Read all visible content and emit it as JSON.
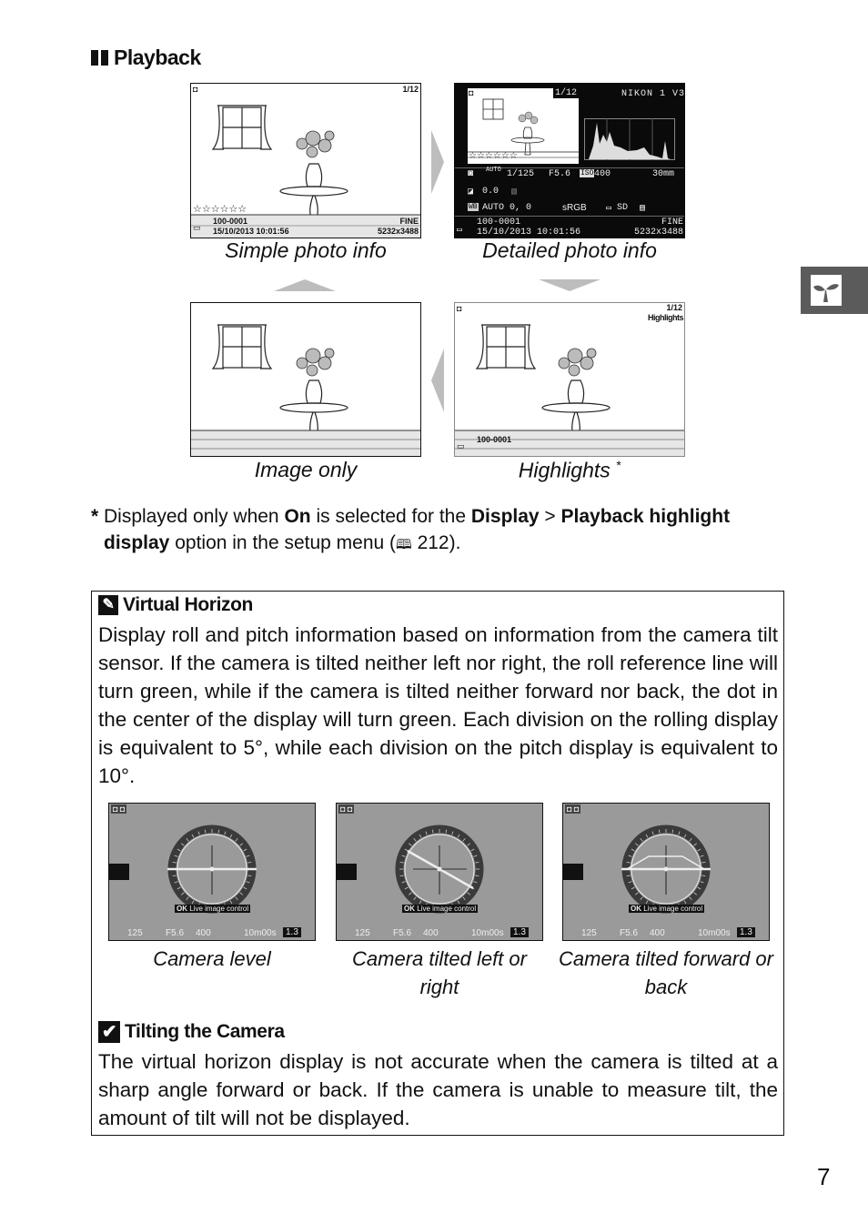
{
  "section": {
    "title": "Playback"
  },
  "playback_views": [
    {
      "id": "simple",
      "caption": "Simple photo info",
      "frame": "1/12",
      "file": "100-0001",
      "date": "15/10/2013  10:01:56",
      "quality": "FINE",
      "size": "5232x3488",
      "rating": "☆☆☆☆☆☆"
    },
    {
      "id": "detailed",
      "caption": "Detailed photo info",
      "frame": "1/12",
      "model": "NIKON 1 V3",
      "shutter": "1/125",
      "aperture": "F5.6",
      "iso_label": "ISO",
      "iso": "400",
      "focal": "30mm",
      "exposure_comp": "0.0",
      "wb_label": "WB",
      "wb": "AUTO",
      "wb_fine": "0, 0",
      "color_space": "sRGB",
      "picture_control": "SD",
      "file": "100-0001",
      "date": "15/10/2013 10:01:56",
      "quality": "FINE",
      "size": "5232x3488",
      "auto_label": "AUTO",
      "rating": "☆☆☆☆☆☆"
    },
    {
      "id": "image_only",
      "caption": "Image only"
    },
    {
      "id": "highlights",
      "caption": "Highlights",
      "caption_mark": "*",
      "frame": "1/12",
      "label": "Highlights",
      "file": "100-0001"
    }
  ],
  "chapter_tab": {
    "icon": "sprout-icon"
  },
  "footnote": {
    "mark": "*",
    "t1": "Displayed only when ",
    "b1": "On",
    "t2": " is selected for the ",
    "b2": "Display",
    "t3": " > ",
    "b3": "Playback highlight display",
    "t4": " option in the setup menu (",
    "ref_icon": "book-icon",
    "ref_page": "212",
    "t5": ")."
  },
  "virtual_horizon": {
    "title": "Virtual Horizon",
    "body": "Display roll and pitch information based on information from the camera tilt sensor. If the camera is tilted neither left nor right, the roll reference line will turn green, while if the camera is tilted neither forward nor back, the dot in the center of the display will turn green. Each division on the rolling display is equivalent to 5°, while each division on the pitch display is equivalent to 10°.",
    "screens": [
      {
        "caption": "Camera level",
        "tilt": "level"
      },
      {
        "caption": "Camera tilted left or right",
        "tilt": "roll"
      },
      {
        "caption": "Camera tilted forward or back",
        "tilt": "pitch"
      }
    ],
    "osd": {
      "ok": "OK",
      "live": "Live image control",
      "shutter": "125",
      "aperture": "F5.6",
      "iso": "400",
      "time": "10m00s",
      "value": "1.3"
    }
  },
  "tilting": {
    "title": "Tilting the Camera",
    "body": "The virtual horizon display is not accurate when the camera is tilted at a sharp angle forward or back. If the camera is unable to measure tilt, the amount of tilt will not be displayed."
  },
  "page_number": "7"
}
